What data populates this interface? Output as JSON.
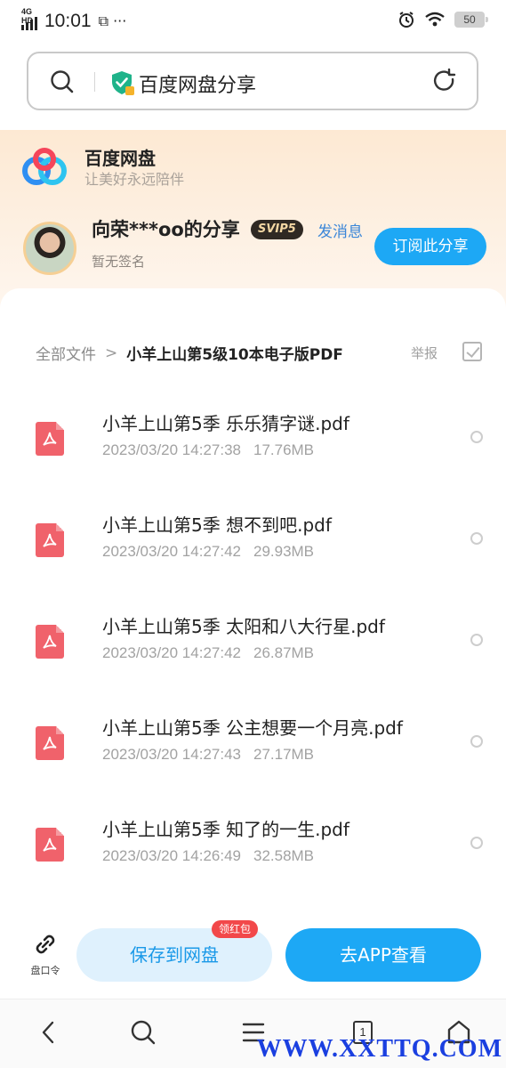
{
  "status_bar": {
    "network": "4G HD",
    "time": "10:01",
    "extra": "\u0001 …",
    "battery": "50"
  },
  "search_bar": {
    "query": "百度网盘分享"
  },
  "brand": {
    "name": "百度网盘",
    "slogan": "让美好永远陪伴"
  },
  "share": {
    "sharer": "向荣***oo的分享",
    "vip_badge": "SVIP5",
    "message_label": "发消息",
    "signature": "暂无签名",
    "subscribe_label": "订阅此分享"
  },
  "breadcrumb": {
    "root": "全部文件",
    "separator": ">",
    "current": "小羊上山第5级10本电子版PDF"
  },
  "toolbar": {
    "report_label": "举报"
  },
  "files": [
    {
      "name": "小羊上山第5季 乐乐猜字谜.pdf",
      "date": "2023/03/20 14:27:38",
      "size": "17.76MB"
    },
    {
      "name": "小羊上山第5季 想不到吧.pdf",
      "date": "2023/03/20 14:27:42",
      "size": "29.93MB"
    },
    {
      "name": "小羊上山第5季 太阳和八大行星.pdf",
      "date": "2023/03/20 14:27:42",
      "size": "26.87MB"
    },
    {
      "name": "小羊上山第5季 公主想要一个月亮.pdf",
      "date": "2023/03/20 14:27:43",
      "size": "27.17MB"
    },
    {
      "name": "小羊上山第5季 知了的一生.pdf",
      "date": "2023/03/20 14:26:49",
      "size": "32.58MB"
    }
  ],
  "actions": {
    "code_label": "盘口令",
    "save_label": "保存到网盘",
    "red_badge": "领红包",
    "app_label": "去APP查看"
  },
  "nav": {
    "tab_count": "1"
  },
  "watermark": "WWW.XXTTQ.COM",
  "colors": {
    "accent": "#1da8f5",
    "pdf": "#f0626b",
    "header_bg": "#fde9d3"
  }
}
